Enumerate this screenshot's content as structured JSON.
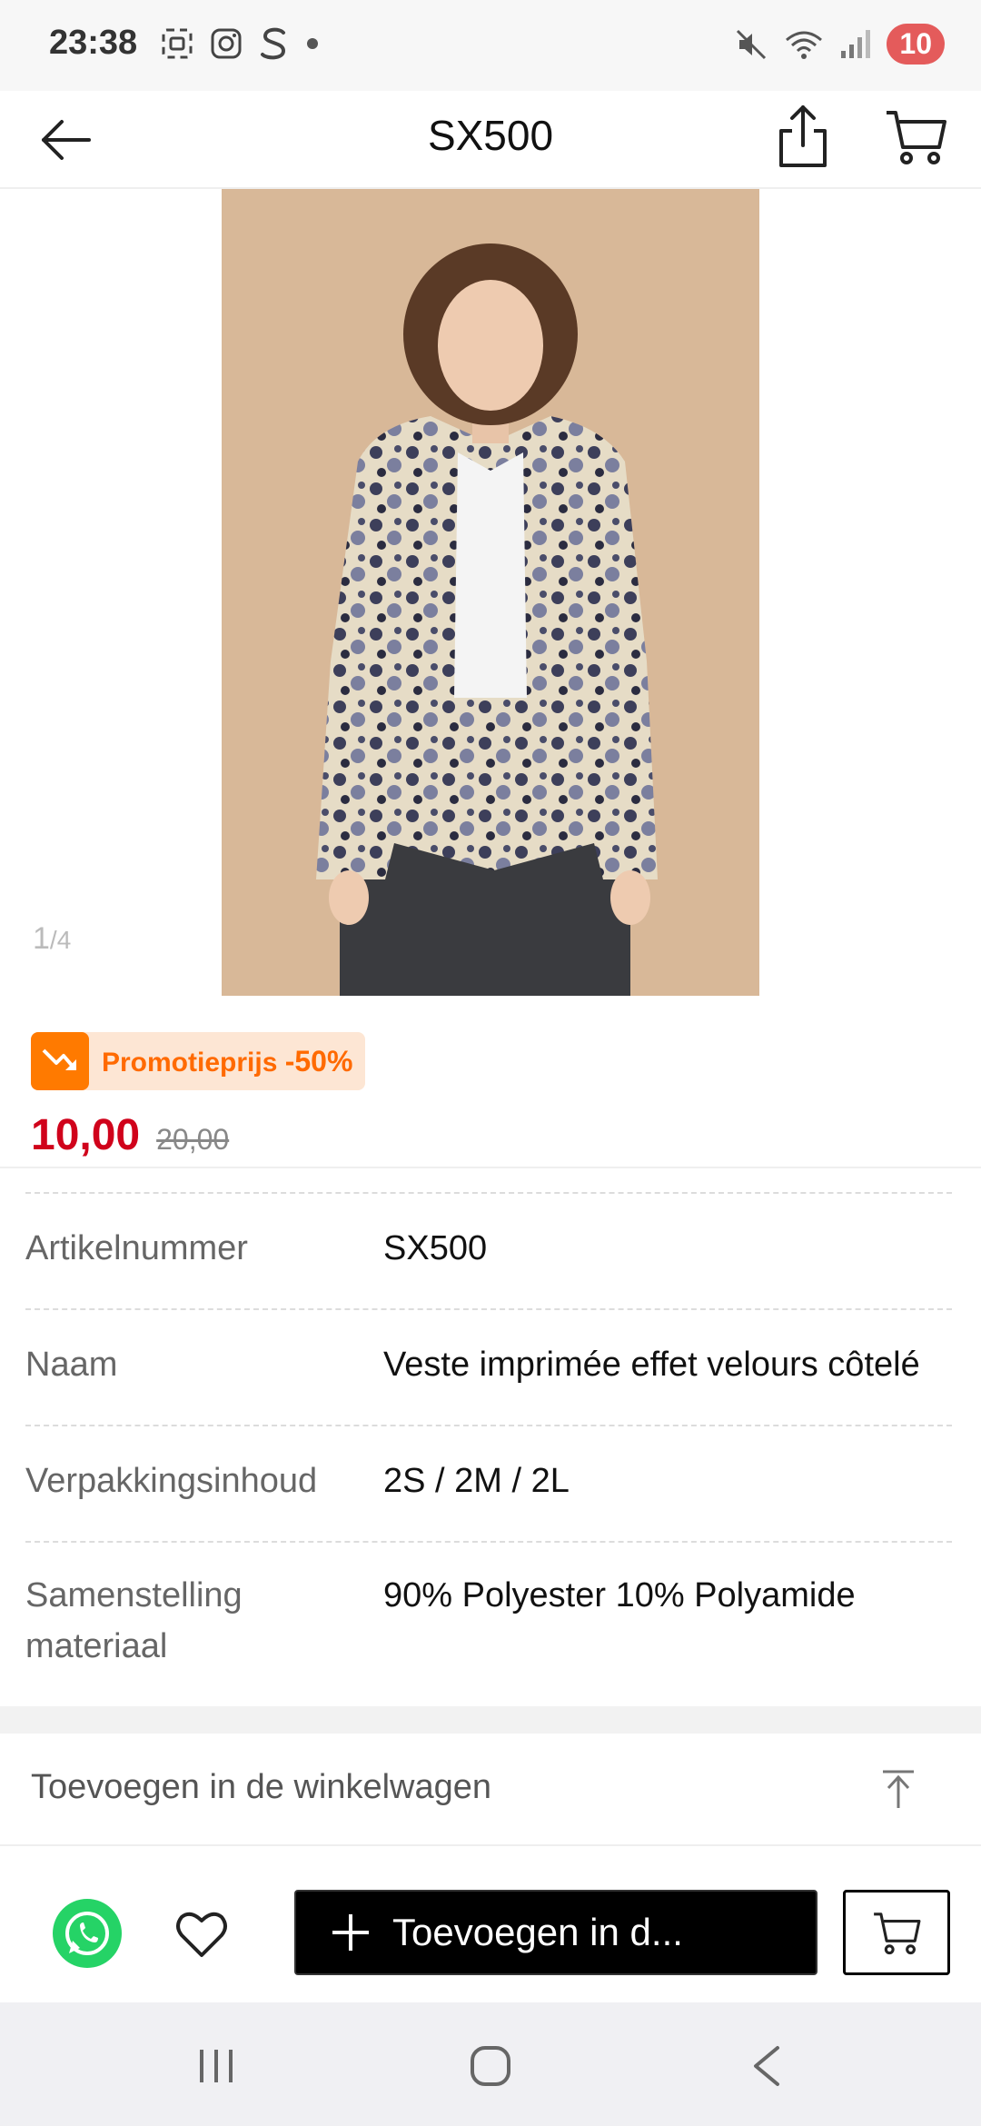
{
  "status_bar": {
    "time": "23:38",
    "battery": "10",
    "icons_left": [
      "screenshot-icon",
      "instagram-icon",
      "s-app-icon",
      "dot-icon"
    ],
    "icons_right": [
      "mute-icon",
      "wifi-icon",
      "signal-icon"
    ]
  },
  "header": {
    "title": "SX500"
  },
  "gallery": {
    "current": "1",
    "total": "/4"
  },
  "promo": {
    "label": "Promotieprijs",
    "discount": "-50%"
  },
  "price": {
    "current": "10,00",
    "original": "20,00"
  },
  "specs": [
    {
      "label": "Artikelnummer",
      "value": "SX500"
    },
    {
      "label": "Naam",
      "value": "Veste imprimée effet velours côtelé"
    },
    {
      "label": "Verpakkingsinhoud",
      "value": "2S / 2M / 2L"
    },
    {
      "label": "Samenstelling materiaal",
      "value": "90% Polyester 10% Polyamide"
    }
  ],
  "add_to_cart_section": {
    "label": "Toevoegen in de winkelwagen"
  },
  "action_bar": {
    "primary_label": "Toevoegen in d..."
  },
  "colors": {
    "price_red": "#d0021b",
    "promo_orange": "#ff6a00",
    "promo_bg": "#fde6d4",
    "whatsapp_green": "#25d366"
  }
}
